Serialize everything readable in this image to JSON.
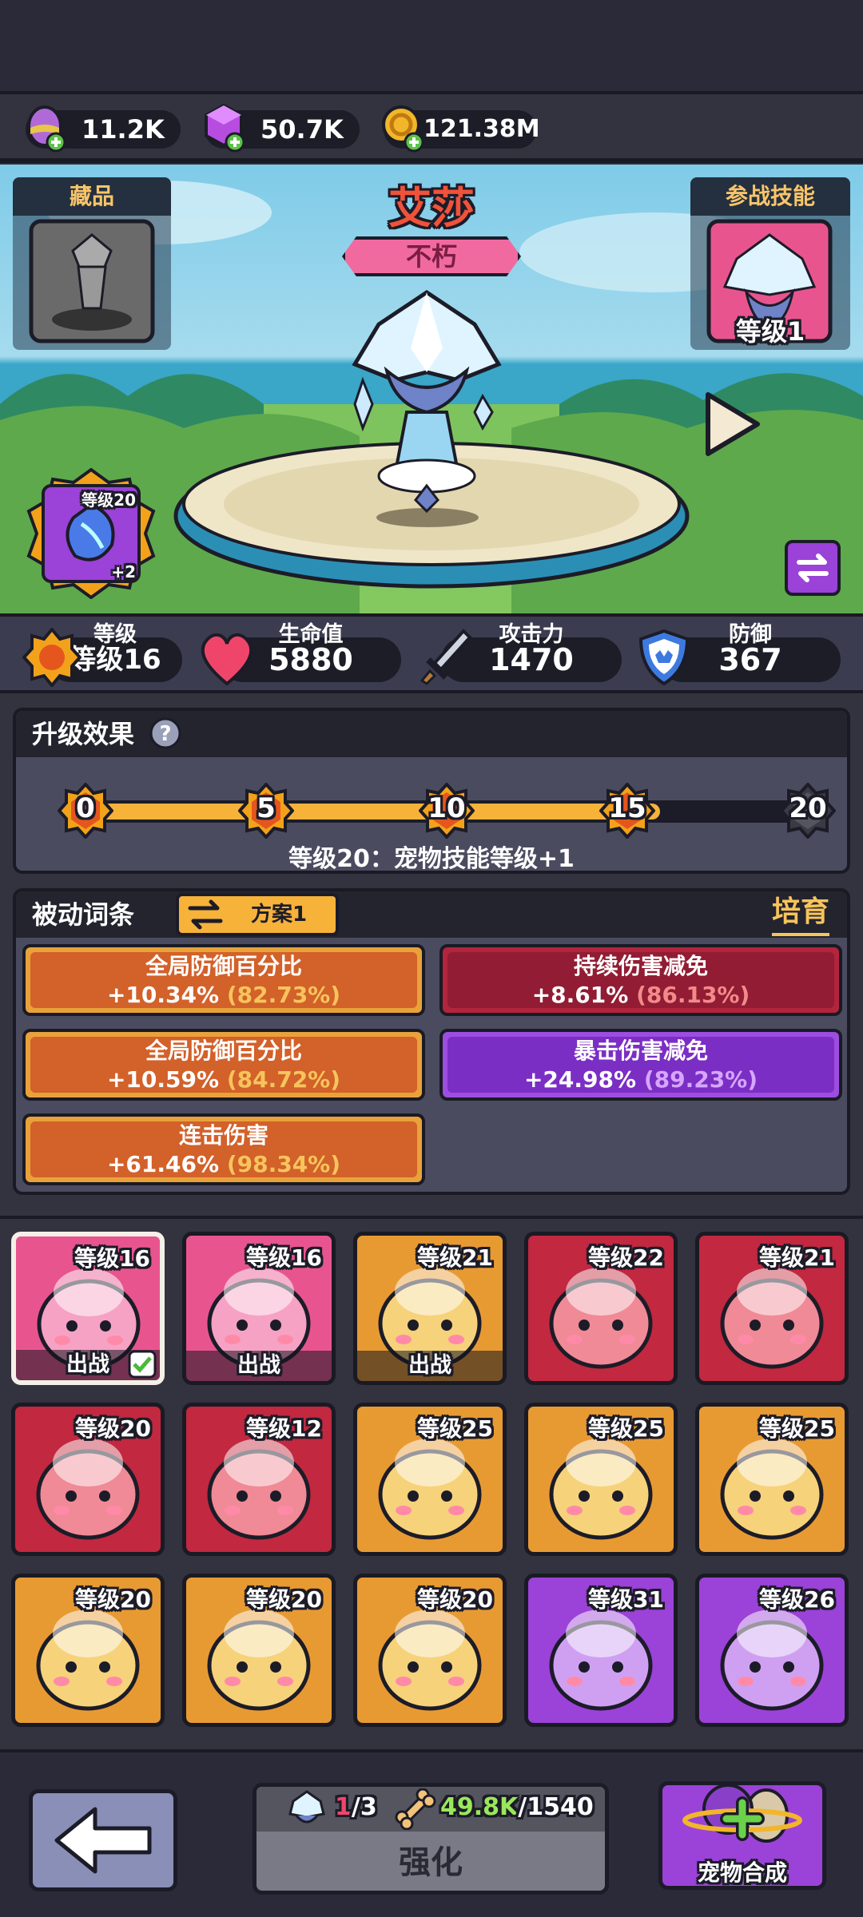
{
  "currency": {
    "eggs": "11.2K",
    "gems": "50.7K",
    "coins": "121.38M"
  },
  "hero": {
    "name": "艾莎",
    "title": "不朽"
  },
  "collection": {
    "label": "藏品"
  },
  "battle_skill": {
    "label": "参战技能",
    "level": "等级1"
  },
  "equipment": {
    "level": "等级20",
    "bonus": "+2"
  },
  "stats": {
    "level_label": "等级",
    "level_value": "等级16",
    "hp_label": "生命值",
    "hp_value": "5880",
    "atk_label": "攻击力",
    "atk_value": "1470",
    "def_label": "防御",
    "def_value": "367"
  },
  "upgrade": {
    "title": "升级效果",
    "milestones": [
      "0",
      "5",
      "10",
      "15",
      "20"
    ],
    "progress": 0.8,
    "effect_text": "等级20：宠物技能等级+1"
  },
  "passive": {
    "title": "被动词条",
    "scheme_label": "方案1",
    "cultivate_label": "培育",
    "affixes": [
      {
        "name": "全局防御百分比",
        "value": "+10.34%",
        "pct": "(82.73%)",
        "rarity": "orange"
      },
      {
        "name": "持续伤害减免",
        "value": "+8.61%",
        "pct": "(86.13%)",
        "rarity": "red"
      },
      {
        "name": "全局防御百分比",
        "value": "+10.59%",
        "pct": "(84.72%)",
        "rarity": "orange"
      },
      {
        "name": "暴击伤害减免",
        "value": "+24.98%",
        "pct": "(89.23%)",
        "rarity": "purple"
      },
      {
        "name": "连击伤害",
        "value": "+61.46%",
        "pct": "(98.34%)",
        "rarity": "orange"
      }
    ]
  },
  "pets": [
    {
      "level": "等级16",
      "deployed": "出战",
      "rarity": "pink",
      "icon": "ice-crystal-pet-icon",
      "selected": true
    },
    {
      "level": "等级16",
      "deployed": "出战",
      "rarity": "pink",
      "icon": "pig-pet-icon"
    },
    {
      "level": "等级21",
      "deployed": "出战",
      "rarity": "orange",
      "icon": "king-bird-pet-icon"
    },
    {
      "level": "等级22",
      "rarity": "red",
      "icon": "unicorn-slime-pet-icon"
    },
    {
      "level": "等级21",
      "rarity": "red",
      "icon": "winged-cat-pet-icon"
    },
    {
      "level": "等级20",
      "rarity": "red",
      "icon": "red-dragon-pet-icon"
    },
    {
      "level": "等级12",
      "rarity": "red",
      "icon": "thunder-cloud-pet-icon"
    },
    {
      "level": "等级25",
      "rarity": "orange",
      "icon": "onion-pet-icon"
    },
    {
      "level": "等级25",
      "rarity": "orange",
      "icon": "mushroom-pet-icon"
    },
    {
      "level": "等级25",
      "rarity": "orange",
      "icon": "fox-pet-icon"
    },
    {
      "level": "等级20",
      "rarity": "orange",
      "icon": "ram-pet-icon"
    },
    {
      "level": "等级20",
      "rarity": "orange",
      "icon": "bunny-pet-icon"
    },
    {
      "level": "等级20",
      "rarity": "orange",
      "icon": "cactus-boxer-pet-icon"
    },
    {
      "level": "等级31",
      "rarity": "purple",
      "icon": "blue-bird-pet-icon"
    },
    {
      "level": "等级26",
      "rarity": "purple",
      "icon": "eagle-pet-icon"
    }
  ],
  "bottom": {
    "owned": "1",
    "owned_total": "/3",
    "bones": "49.8K",
    "bones_cost": "/1540",
    "enhance_label": "强化",
    "synth_label": "宠物合成"
  }
}
